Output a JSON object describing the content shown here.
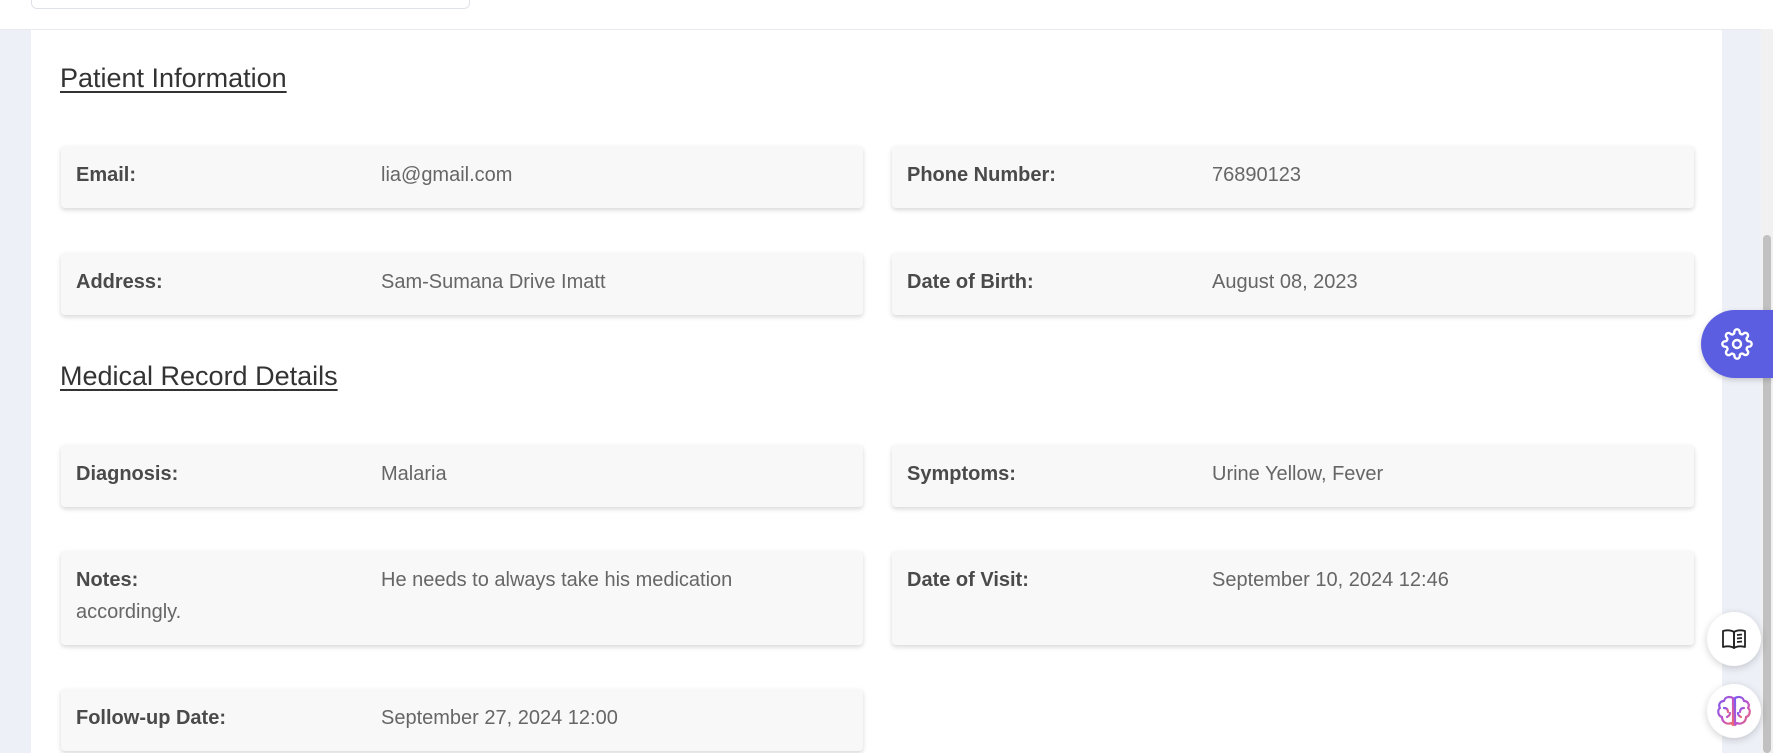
{
  "sections": {
    "patient_info_title": "Patient Information",
    "medical_record_title": "Medical Record Details"
  },
  "patient": {
    "email_label": "Email:",
    "email_value": "lia@gmail.com",
    "phone_label": "Phone Number:",
    "phone_value": "76890123",
    "address_label": "Address:",
    "address_value": "Sam-Sumana Drive Imatt",
    "dob_label": "Date of Birth:",
    "dob_value": "August 08, 2023"
  },
  "record": {
    "diagnosis_label": "Diagnosis:",
    "diagnosis_value": "Malaria",
    "symptoms_label": "Symptoms:",
    "symptoms_value": "Urine Yellow, Fever",
    "notes_label": "Notes:",
    "notes_value": "He needs to always take his medication accordingly.",
    "visit_label": "Date of Visit:",
    "visit_value": "September 10, 2024 12:46",
    "followup_label": "Follow-up Date:",
    "followup_value": "September 27, 2024 12:00"
  },
  "floating": {
    "settings_icon": "gear-icon",
    "docs_icon": "book-icon",
    "ai_icon": "brain-icon",
    "accent_color": "#5b5ee0"
  }
}
